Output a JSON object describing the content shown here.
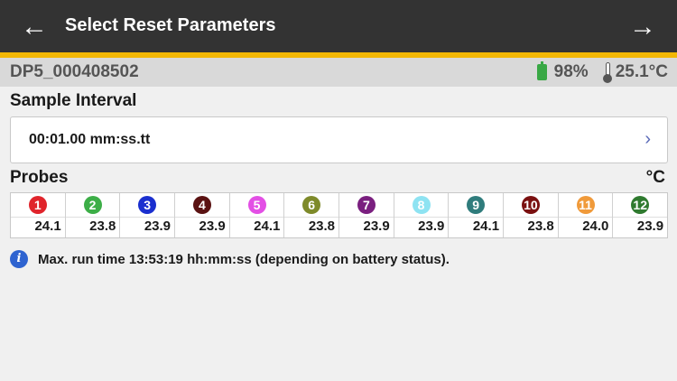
{
  "header": {
    "title": "Select Reset Parameters",
    "back_glyph": "←",
    "forward_glyph": "→"
  },
  "device": {
    "name": "DP5_000408502",
    "battery": "98%",
    "battery_level": 0.98,
    "temperature": "25.1°C"
  },
  "sample_interval": {
    "label": "Sample Interval",
    "value": "00:01.00 mm:ss.tt",
    "chevron": "›"
  },
  "probes": {
    "label": "Probes",
    "unit": "°C",
    "items": [
      {
        "num": "1",
        "value": "24.1",
        "color": "#e0242b"
      },
      {
        "num": "2",
        "value": "23.8",
        "color": "#3cae47"
      },
      {
        "num": "3",
        "value": "23.9",
        "color": "#1a2fcf"
      },
      {
        "num": "4",
        "value": "23.9",
        "color": "#5a1212"
      },
      {
        "num": "5",
        "value": "24.1",
        "color": "#e34fe5"
      },
      {
        "num": "6",
        "value": "23.8",
        "color": "#7e8a2a"
      },
      {
        "num": "7",
        "value": "23.9",
        "color": "#7a1f7f"
      },
      {
        "num": "8",
        "value": "23.9",
        "color": "#8ee3f2"
      },
      {
        "num": "9",
        "value": "24.1",
        "color": "#2f7c7c"
      },
      {
        "num": "10",
        "value": "23.8",
        "color": "#7a1010"
      },
      {
        "num": "11",
        "value": "24.0",
        "color": "#f09a3a"
      },
      {
        "num": "12",
        "value": "23.9",
        "color": "#2f7a2f"
      }
    ]
  },
  "info": {
    "icon": "i",
    "text": "Max. run time 13:53:19 hh:mm:ss (depending on battery status)."
  }
}
